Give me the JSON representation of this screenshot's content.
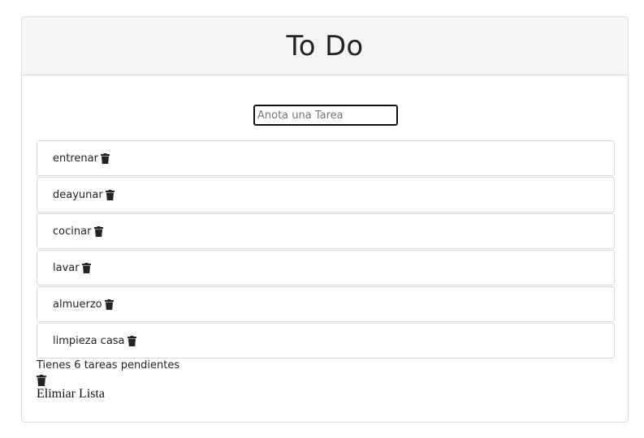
{
  "header": {
    "title": "To Do"
  },
  "input": {
    "placeholder": "Anota una Tarea",
    "value": ""
  },
  "tasks": [
    {
      "label": "entrenar",
      "icon": "trash-icon"
    },
    {
      "label": "deayunar",
      "icon": "trash-icon"
    },
    {
      "label": "cocinar",
      "icon": "trash-icon"
    },
    {
      "label": "lavar",
      "icon": "trash-icon"
    },
    {
      "label": "almuerzo",
      "icon": "trash-icon"
    },
    {
      "label": "limpieza casa",
      "icon": "trash-icon"
    }
  ],
  "footer": {
    "pending_text": "Tienes 6 tareas pendientes",
    "clear_icon": "trash-icon",
    "clear_label": "Elimiar Lista"
  },
  "colors": {
    "header_bg": "#f5f5f5",
    "border": "#dcdcdc",
    "text": "#212529",
    "icon": "#212529"
  }
}
